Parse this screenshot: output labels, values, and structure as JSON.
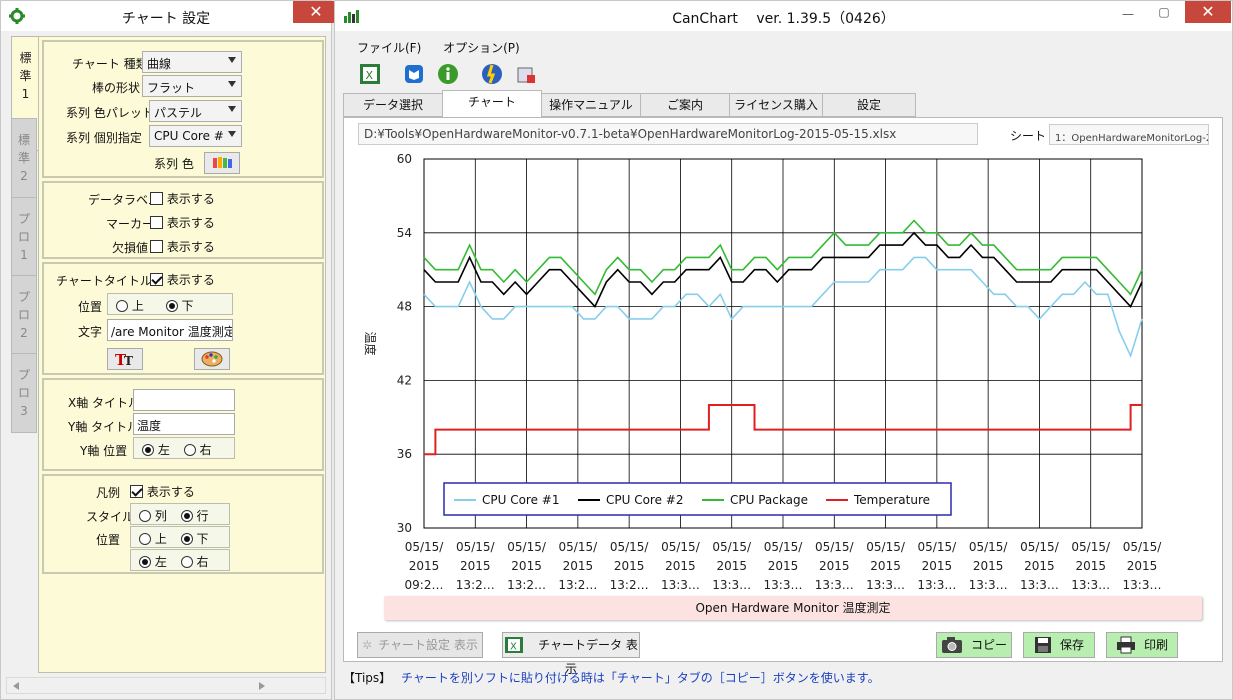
{
  "left_window": {
    "title": "チャート 設定",
    "close": "✕",
    "vtabs": [
      {
        "label": "標\n準\n1",
        "active": true
      },
      {
        "label": "標\n準\n2",
        "active": false
      },
      {
        "label": "プ\nロ\n1",
        "active": false
      },
      {
        "label": "プ\nロ\n2",
        "active": false
      },
      {
        "label": "プ\nロ\n3",
        "active": false
      }
    ],
    "chart_group": {
      "type_label": "チャート 種類",
      "type_value": "曲線",
      "bar_label": "棒の形状",
      "bar_value": "フラット",
      "palette_label": "系列 色パレット",
      "palette_value": "パステル",
      "series_label": "系列 個別指定",
      "series_value": "CPU Core #",
      "color_label": "系列 色"
    },
    "label_group": {
      "datalabel": "データラベル",
      "marker": "マーカー",
      "missing": "欠損値",
      "show": "表示する"
    },
    "title_group": {
      "label": "チャートタイトル",
      "show": "表示する",
      "pos_label": "位置",
      "top": "上",
      "bottom": "下",
      "text_label": "文字",
      "text_value": "/are Monitor 温度測定"
    },
    "axis_group": {
      "x_label": "X軸 タイトル",
      "x_value": "",
      "y_label": "Y軸 タイトル",
      "y_value": "温度",
      "ypos_label": "Y軸 位置",
      "left": "左",
      "right": "右"
    },
    "legend_group": {
      "label": "凡例",
      "show": "表示する",
      "style_label": "スタイル",
      "col": "列",
      "row": "行",
      "pos_label": "位置",
      "top": "上",
      "bottom": "下",
      "left": "左",
      "right": "右"
    }
  },
  "main_window": {
    "title": "CanChart　 ver. 1.39.5（0426）",
    "menu": [
      "ファイル(F)",
      "オプション(P)"
    ],
    "tabs": [
      "データ選択",
      "チャート",
      "操作マニュアル",
      "ご案内",
      "ライセンス購入",
      "設定"
    ],
    "active_tab": 1,
    "path": "D:¥Tools¥OpenHardwareMonitor-v0.7.1-beta¥OpenHardwareMonitorLog-2015-05-15.xlsx",
    "sheet_label": "シート",
    "sheet_value": "1：OpenHardwareMonitorLog-2",
    "buttons": {
      "chart_setting": "チャート設定 表示",
      "chart_data": "チャートデータ 表示",
      "copy": "コピー",
      "save": "保存",
      "print": "印刷"
    },
    "tips_prefix": "【Tips】",
    "tips_text": "チャートを別ソフトに貼り付ける時は「チャート」タブの［コピー］ボタンを使います。"
  },
  "colors": {
    "core1": "#87ceeb",
    "core2": "#000000",
    "package": "#33bb33",
    "temp": "#e02020"
  },
  "chart_data": {
    "type": "line",
    "title": "Open  Hardware  Monitor 温度測定",
    "ylabel": "温度",
    "xlabel": "",
    "ylim": [
      30,
      60
    ],
    "yticks": [
      30,
      36,
      42,
      48,
      54,
      60
    ],
    "xtick_labels": [
      [
        "05/15/",
        "2015",
        "09:2…"
      ],
      [
        "05/15/",
        "2015",
        "13:2…"
      ],
      [
        "05/15/",
        "2015",
        "13:2…"
      ],
      [
        "05/15/",
        "2015",
        "13:2…"
      ],
      [
        "05/15/",
        "2015",
        "13:2…"
      ],
      [
        "05/15/",
        "2015",
        "13:3…"
      ],
      [
        "05/15/",
        "2015",
        "13:3…"
      ],
      [
        "05/15/",
        "2015",
        "13:3…"
      ],
      [
        "05/15/",
        "2015",
        "13:3…"
      ],
      [
        "05/15/",
        "2015",
        "13:3…"
      ],
      [
        "05/15/",
        "2015",
        "13:3…"
      ],
      [
        "05/15/",
        "2015",
        "13:3…"
      ],
      [
        "05/15/",
        "2015",
        "13:3…"
      ],
      [
        "05/15/",
        "2015",
        "13:3…"
      ],
      [
        "05/15/",
        "2015",
        "13:3…"
      ]
    ],
    "grid": true,
    "legend_position": "bottom-center",
    "series": [
      {
        "name": "CPU Core #1",
        "values": [
          49,
          48,
          48,
          48,
          50,
          48,
          47,
          47,
          48,
          48,
          48,
          48,
          48,
          48,
          47,
          47,
          48,
          48,
          47,
          47,
          47,
          48,
          48,
          49,
          49,
          48,
          49,
          47,
          48,
          48,
          48,
          48,
          48,
          48,
          48,
          49,
          50,
          50,
          50,
          50,
          51,
          51,
          51,
          52,
          52,
          51,
          51,
          51,
          51,
          50,
          49,
          49,
          48,
          48,
          47,
          48,
          49,
          49,
          50,
          49,
          49,
          46,
          44,
          47
        ]
      },
      {
        "name": "CPU Core #2",
        "values": [
          51,
          50,
          50,
          50,
          52,
          50,
          50,
          49,
          50,
          49,
          50,
          51,
          51,
          50,
          49,
          48,
          50,
          51,
          50,
          50,
          49,
          50,
          50,
          51,
          51,
          51,
          52,
          50,
          50,
          51,
          51,
          50,
          51,
          51,
          51,
          52,
          52,
          52,
          52,
          52,
          53,
          53,
          53,
          54,
          53,
          53,
          52,
          52,
          53,
          52,
          52,
          51,
          50,
          50,
          50,
          50,
          51,
          51,
          51,
          51,
          50,
          49,
          48,
          50
        ]
      },
      {
        "name": "CPU Package",
        "values": [
          52,
          51,
          51,
          51,
          53,
          51,
          51,
          50,
          51,
          50,
          51,
          52,
          52,
          51,
          50,
          49,
          51,
          52,
          51,
          51,
          50,
          51,
          51,
          52,
          52,
          52,
          53,
          51,
          51,
          52,
          52,
          51,
          52,
          52,
          52,
          53,
          54,
          53,
          53,
          53,
          54,
          54,
          54,
          55,
          54,
          54,
          53,
          53,
          54,
          53,
          53,
          52,
          51,
          51,
          51,
          51,
          52,
          52,
          52,
          52,
          51,
          50,
          49,
          51
        ]
      },
      {
        "name": "Temperature",
        "values": [
          36,
          38,
          38,
          38,
          38,
          38,
          38,
          38,
          38,
          38,
          38,
          38,
          38,
          38,
          38,
          38,
          38,
          38,
          38,
          38,
          38,
          38,
          38,
          38,
          38,
          40,
          40,
          40,
          40,
          38,
          38,
          38,
          38,
          38,
          38,
          38,
          38,
          38,
          38,
          38,
          38,
          38,
          38,
          38,
          38,
          38,
          38,
          38,
          38,
          38,
          38,
          38,
          38,
          38,
          38,
          38,
          38,
          38,
          38,
          38,
          38,
          38,
          40,
          40
        ]
      }
    ]
  }
}
